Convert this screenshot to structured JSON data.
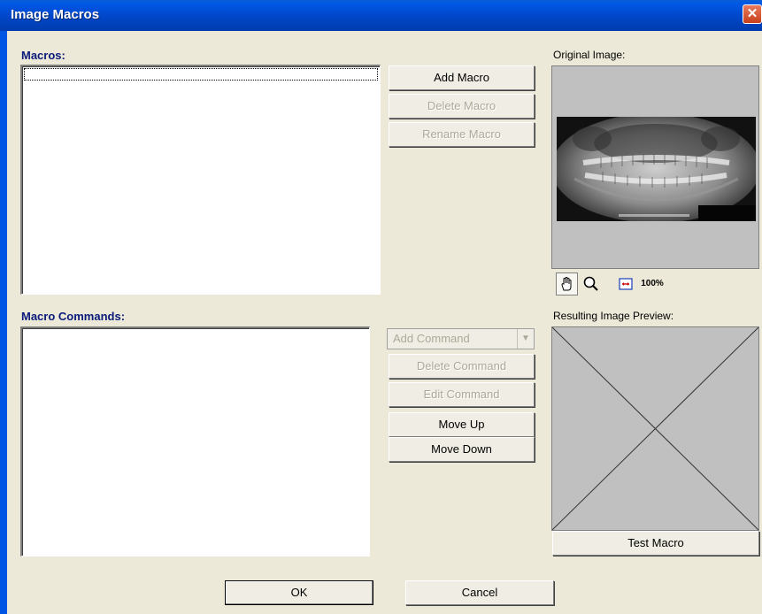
{
  "window": {
    "title": "Image Macros",
    "close_glyph": "✕"
  },
  "macros": {
    "label": "Macros:",
    "items": []
  },
  "macro_buttons": {
    "add": "Add Macro",
    "delete": "Delete Macro",
    "rename": "Rename Macro"
  },
  "commands": {
    "label": "Macro Commands:",
    "items": []
  },
  "command_buttons": {
    "add": "Add Command",
    "add_arrow": "▼",
    "delete": "Delete Command",
    "edit": "Edit Command",
    "move_up": "Move Up",
    "move_down": "Move Down"
  },
  "original": {
    "label": "Original Image:"
  },
  "tools": {
    "pan_icon": "pan-hand-icon",
    "zoom_icon": "magnifier-icon",
    "fit_icon": "fit-width-icon",
    "zoom_100": "100%"
  },
  "preview": {
    "label": "Resulting Image Preview:",
    "test_button": "Test Macro"
  },
  "dialog_buttons": {
    "ok": "OK",
    "cancel": "Cancel"
  },
  "colors": {
    "title_bar": "#0046c8",
    "label_blue": "#0a1a7a",
    "dialog_bg": "#ece9d8",
    "disabled_text": "#aca899"
  }
}
